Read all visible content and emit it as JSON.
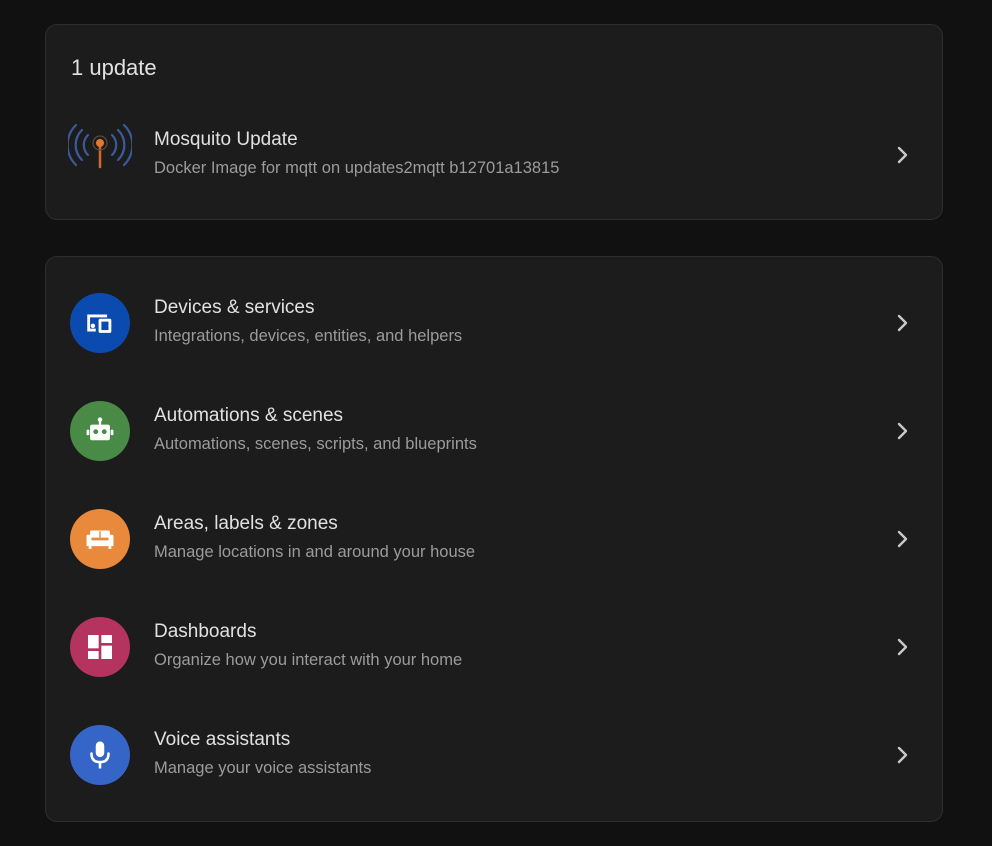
{
  "updates": {
    "header": "1 update",
    "items": [
      {
        "title": "Mosquito Update",
        "subtitle": "Docker Image for mqtt on updates2mqtt b12701a13815",
        "icon": "antenna-signal-icon"
      }
    ]
  },
  "menu": {
    "items": [
      {
        "title": "Devices & services",
        "subtitle": "Integrations, devices, entities, and helpers",
        "icon": "devices-icon",
        "color": "#0b4bb0"
      },
      {
        "title": "Automations & scenes",
        "subtitle": "Automations, scenes, scripts, and blueprints",
        "icon": "robot-icon",
        "color": "#4a8a47"
      },
      {
        "title": "Areas, labels & zones",
        "subtitle": "Manage locations in and around your house",
        "icon": "sofa-icon",
        "color": "#e9893b"
      },
      {
        "title": "Dashboards",
        "subtitle": "Organize how you interact with your home",
        "icon": "dashboard-icon",
        "color": "#b5335f"
      },
      {
        "title": "Voice assistants",
        "subtitle": "Manage your voice assistants",
        "icon": "microphone-icon",
        "color": "#3665c8"
      }
    ]
  }
}
